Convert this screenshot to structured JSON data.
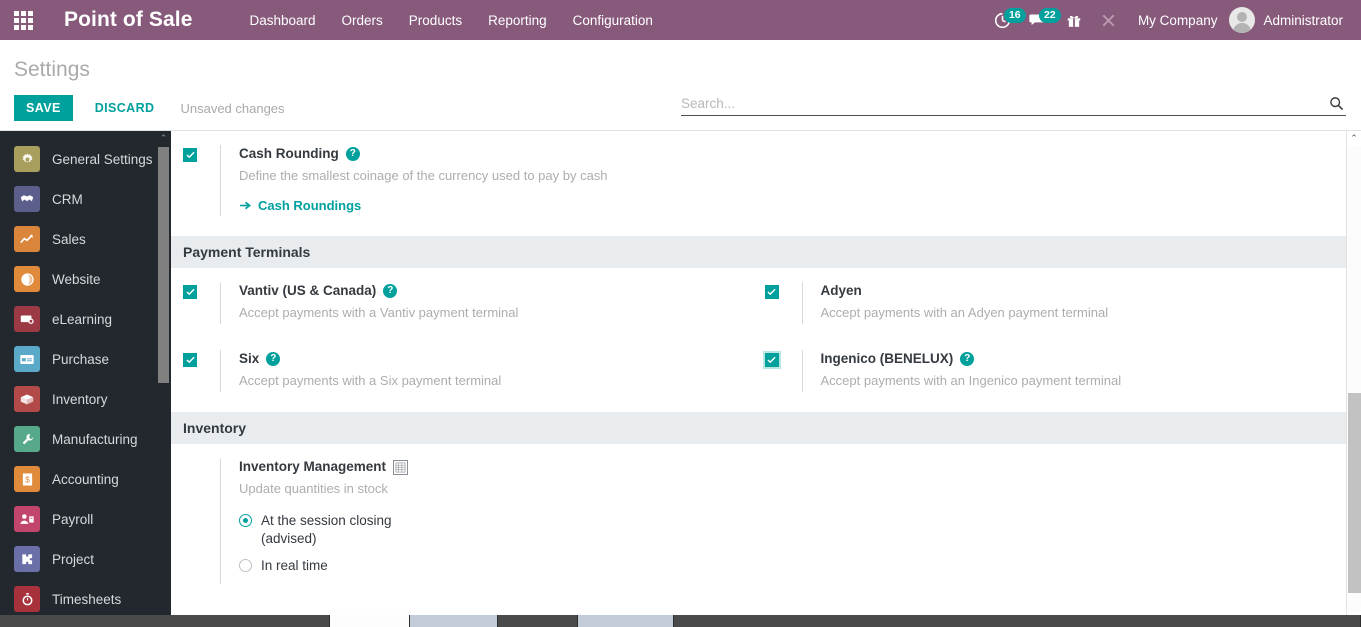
{
  "navbar": {
    "apps_icon": "apps-grid-icon",
    "brand": "Point of Sale",
    "menu": [
      {
        "label": "Dashboard"
      },
      {
        "label": "Orders"
      },
      {
        "label": "Products"
      },
      {
        "label": "Reporting"
      },
      {
        "label": "Configuration"
      }
    ],
    "activities": {
      "icon": "clock-activity-icon",
      "count": "16"
    },
    "messages": {
      "icon": "chat-bubble-icon",
      "count": "22"
    },
    "gift": {
      "icon": "gift-icon"
    },
    "tools": {
      "icon": "crossed-tools-icon"
    },
    "company": "My Company",
    "user": "Administrator",
    "avatar_icon": "user-avatar-icon",
    "brand_color": "#875a7b",
    "badge_color": "#00a09d"
  },
  "control_panel": {
    "title": "Settings",
    "save_label": "SAVE",
    "discard_label": "DISCARD",
    "unsaved_note": "Unsaved changes",
    "accent_color": "#00a09d"
  },
  "search": {
    "placeholder": "Search...",
    "value": "",
    "icon": "search-icon"
  },
  "sidebar": {
    "items": [
      {
        "label": "General Settings",
        "icon": "gear-icon",
        "color": "#a99f5c"
      },
      {
        "label": "CRM",
        "icon": "handshake-icon",
        "color": "#5c5f8c"
      },
      {
        "label": "Sales",
        "icon": "chart-line-icon",
        "color": "#d9853b"
      },
      {
        "label": "Website",
        "icon": "globe-icon",
        "color": "#e08a3c"
      },
      {
        "label": "eLearning",
        "icon": "presentation-icon",
        "color": "#9b3a45"
      },
      {
        "label": "Purchase",
        "icon": "card-icon",
        "color": "#5aa9c9"
      },
      {
        "label": "Inventory",
        "icon": "box-icon",
        "color": "#b24a4a"
      },
      {
        "label": "Manufacturing",
        "icon": "wrench-icon",
        "color": "#56a98a"
      },
      {
        "label": "Accounting",
        "icon": "invoice-icon",
        "color": "#e08a3c"
      },
      {
        "label": "Payroll",
        "icon": "employee-icon",
        "color": "#c2456b"
      },
      {
        "label": "Project",
        "icon": "puzzle-icon",
        "color": "#6b6fa8"
      },
      {
        "label": "Timesheets",
        "icon": "stopwatch-icon",
        "color": "#a8323c"
      }
    ]
  },
  "main": {
    "cash_rounding": {
      "title": "Cash Rounding",
      "description": "Define the smallest coinage of the currency used to pay by cash",
      "checked": true,
      "help_icon": "help-icon",
      "link_label": "Cash Roundings",
      "link_icon": "arrow-right-icon"
    },
    "payment_terminals": {
      "section_title": "Payment Terminals",
      "items": [
        {
          "title": "Vantiv (US & Canada)",
          "description": "Accept payments with a Vantiv payment terminal",
          "checked": true,
          "has_help": true,
          "focused": false
        },
        {
          "title": "Adyen",
          "description": "Accept payments with an Adyen payment terminal",
          "checked": true,
          "has_help": false,
          "focused": false
        },
        {
          "title": "Six",
          "description": "Accept payments with a Six payment terminal",
          "checked": true,
          "has_help": true,
          "focused": false
        },
        {
          "title": "Ingenico (BENELUX)",
          "description": "Accept payments with an Ingenico payment terminal",
          "checked": true,
          "has_help": true,
          "focused": true
        }
      ]
    },
    "inventory": {
      "section_title": "Inventory",
      "management": {
        "title": "Inventory Management",
        "description": "Update quantities in stock",
        "doc_icon": "document-grid-icon",
        "options": [
          {
            "label": "At the session closing (advised)",
            "selected": true
          },
          {
            "label": "In real time",
            "selected": false
          }
        ]
      }
    }
  },
  "scrollbars": {
    "up_arrow": "⌃",
    "down_arrow": "⌄"
  }
}
